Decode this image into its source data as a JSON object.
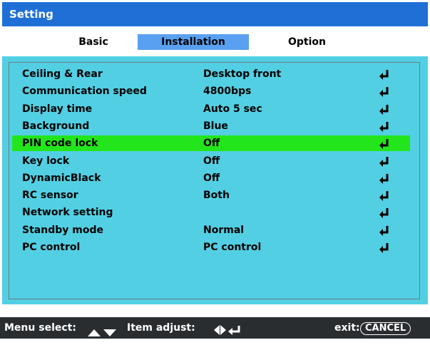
{
  "window": {
    "title": "Setting"
  },
  "tabs": [
    {
      "label": "Basic",
      "active": false
    },
    {
      "label": "Installation",
      "active": true
    },
    {
      "label": "Option",
      "active": false
    }
  ],
  "rows": [
    {
      "label": "Ceiling & Rear",
      "value": "Desktop front",
      "icon": "enter-icon"
    },
    {
      "label": "Communication speed",
      "value": "4800bps",
      "icon": "enter-icon"
    },
    {
      "label": "Display time",
      "value": "Auto  5 sec",
      "icon": "enter-icon"
    },
    {
      "label": "Background",
      "value": "Blue",
      "icon": "enter-icon"
    },
    {
      "label": "PIN code lock",
      "value": "Off",
      "icon": "enter-icon",
      "selected": true
    },
    {
      "label": "Key lock",
      "value": "Off",
      "icon": "enter-icon"
    },
    {
      "label": "DynamicBlack",
      "value": "Off",
      "icon": "enter-icon"
    },
    {
      "label": "RC sensor",
      "value": "Both",
      "icon": "enter-icon"
    },
    {
      "label": "Network setting",
      "value": "",
      "icon": "enter-icon"
    },
    {
      "label": "Standby mode",
      "value": "Normal",
      "icon": "enter-icon"
    },
    {
      "label": "PC control",
      "value": "PC control",
      "icon": "enter-icon"
    }
  ],
  "status": {
    "menu_select_label": "Menu select:",
    "menu_select_icon": "up-down-triangle-icon",
    "item_adjust_label": "Item adjust:",
    "item_adjust_icon": "left-right-enter-icon",
    "exit_label": "exit:",
    "exit_key": "CANCEL"
  },
  "colors": {
    "title_bar": "#1f6fd6",
    "active_tab": "#5aa0f0",
    "panel": "#52cfe3",
    "selected_row": "#22e61b",
    "status_bar": "#2a2d30"
  }
}
